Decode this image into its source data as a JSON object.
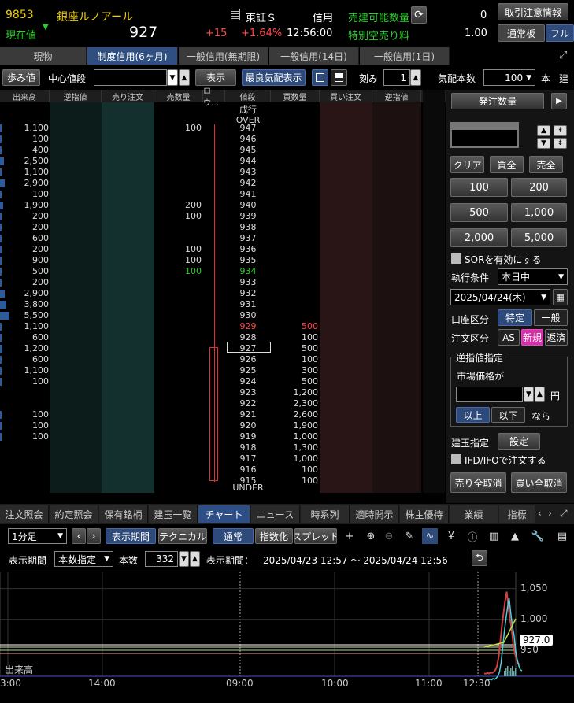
{
  "header": {
    "code": "9853",
    "name": "銀座ルノアール",
    "current_label": "現在値",
    "trend_arrow": "▼",
    "price": "927",
    "change": "+15",
    "change_pct": "+1.64%",
    "time": "12:56:00",
    "market": "東証Ｓ",
    "credit": "信用",
    "sellable_label": "売建可能数量",
    "sellable_value": "0",
    "special_label": "特別空売り料",
    "special_value": "1.00",
    "note_button": "取引注意情報",
    "board_button": "通常板",
    "full_button": "フル"
  },
  "tabs": [
    "現物",
    "制度信用(6ヶ月)",
    "一般信用(無期限)",
    "一般信用(14日)",
    "一般信用(1日)"
  ],
  "toolbar": {
    "tick_button": "歩み値",
    "center_label": "中心値段",
    "display_button": "表示",
    "best_button": "最良気配表示",
    "step_label": "刻み",
    "step_value": "1",
    "quote_label": "気配本数",
    "quote_value": "100",
    "unit": "本",
    "tate": "建"
  },
  "board_headers": [
    "出来高",
    "逆指値",
    "売り注文",
    "売数量",
    "ロウ…",
    "値段",
    "買数量",
    "買い注文",
    "逆指値"
  ],
  "board": {
    "over": "OVER",
    "under": "UNDER",
    "market": "成行",
    "prices": [
      "947",
      "946",
      "945",
      "944",
      "943",
      "942",
      "941",
      "940",
      "939",
      "938",
      "937",
      "936",
      "935",
      "934",
      "933",
      "932",
      "931",
      "930",
      "929",
      "928",
      "927",
      "926",
      "925",
      "924",
      "923",
      "922",
      "921",
      "920",
      "919",
      "918",
      "917",
      "916",
      "915"
    ],
    "volumes": [
      "1,100",
      "100",
      "400",
      "2,500",
      "1,100",
      "2,900",
      "100",
      "1,900",
      "200",
      "200",
      "600",
      "200",
      "900",
      "500",
      "200",
      "2,900",
      "3,800",
      "5,500",
      "1,100",
      "600",
      "1,200",
      "600",
      "1,100",
      "100",
      "",
      "",
      "100",
      "100",
      "100",
      "",
      "",
      "",
      ""
    ],
    "sell_qty": [
      "100",
      "",
      "",
      "",
      "",
      "",
      "",
      "200",
      "100",
      "",
      "",
      "100",
      "100",
      "100",
      "",
      "",
      "",
      "",
      "",
      "",
      "",
      "",
      "",
      "",
      "",
      "",
      "",
      "",
      "",
      "",
      "",
      "",
      ""
    ],
    "buy_qty": [
      "",
      "",
      "",
      "",
      "",
      "",
      "",
      "",
      "",
      "",
      "",
      "",
      "",
      "",
      "",
      "",
      "",
      "",
      "500",
      "100",
      "500",
      "100",
      "300",
      "500",
      "1,200",
      "2,300",
      "2,600",
      "1,900",
      "1,000",
      "1,300",
      "1,000",
      "100",
      "100"
    ],
    "vol_bars": [
      0.2,
      0.04,
      0.07,
      0.45,
      0.2,
      0.53,
      0.02,
      0.35,
      0.04,
      0.04,
      0.11,
      0.04,
      0.16,
      0.09,
      0.04,
      0.53,
      0.69,
      1.0,
      0.2,
      0.11,
      0.22,
      0.11,
      0.2,
      0.02,
      0,
      0,
      0.02,
      0.02,
      0.02,
      0,
      0,
      0,
      0
    ]
  },
  "order": {
    "title": "発注数量",
    "clear": "クリア",
    "buy_all": "買全",
    "sell_all": "売全",
    "qty_buttons": [
      "100",
      "200",
      "500",
      "1,000",
      "2,000",
      "5,000"
    ],
    "sor_label": "SORを有効にする",
    "exec_label": "執行条件",
    "exec_value": "本日中",
    "date_value": "2025/04/24(木)",
    "account_label": "口座区分",
    "account_tokutei": "特定",
    "account_ippan": "一般",
    "order_type_label": "注文区分",
    "as": "AS",
    "new": "新規",
    "close": "返済",
    "stop_title": "逆指値指定",
    "market_label": "市場価格が",
    "yen": "円",
    "above": "以上",
    "below": "以下",
    "nara": "なら",
    "position_label": "建玉指定",
    "setting_button": "設定",
    "ifd_label": "IFD/IFOで注文する",
    "cancel_sell": "売り全取消",
    "cancel_buy": "買い全取消"
  },
  "bottom_tabs": [
    "注文照会",
    "約定照会",
    "保有銘柄",
    "建玉一覧",
    "チャート",
    "ニュース",
    "時系列",
    "適時開示",
    "株主優待",
    "業績",
    "指標"
  ],
  "chart_toolbar": {
    "interval": "1分足",
    "period_button": "表示期間",
    "technical_button": "テクニカル",
    "normal_button": "通常",
    "index_button": "指数化",
    "spread_button": "スプレッド"
  },
  "chart_period": {
    "label": "表示期間",
    "mode": "本数指定",
    "count_label": "本数",
    "count": "332",
    "range_label": "表示期間：",
    "range": "2025/04/23 12:57 〜 2025/04/24 12:56"
  },
  "chart_data": {
    "type": "line",
    "xticks": [
      "3:00",
      "14:00",
      "09:00",
      "10:00",
      "11:00",
      "12:30"
    ],
    "yticks": [
      "1,050",
      "1,000",
      "950"
    ],
    "last_label": "927.0",
    "volume_label": "出来高",
    "series": [
      {
        "values": [
          912,
          912,
          913,
          912,
          914,
          913,
          915,
          918,
          925,
          940,
          965,
          990,
          1010,
          1030,
          1045,
          1020,
          1000,
          985,
          960,
          945,
          935,
          928,
          927
        ]
      }
    ]
  },
  "colors": {
    "accent": "#2d4f85",
    "up": "#e04040",
    "green": "#2bcf2b",
    "sell_col": "#13302e",
    "buy_col": "#2a1516"
  }
}
